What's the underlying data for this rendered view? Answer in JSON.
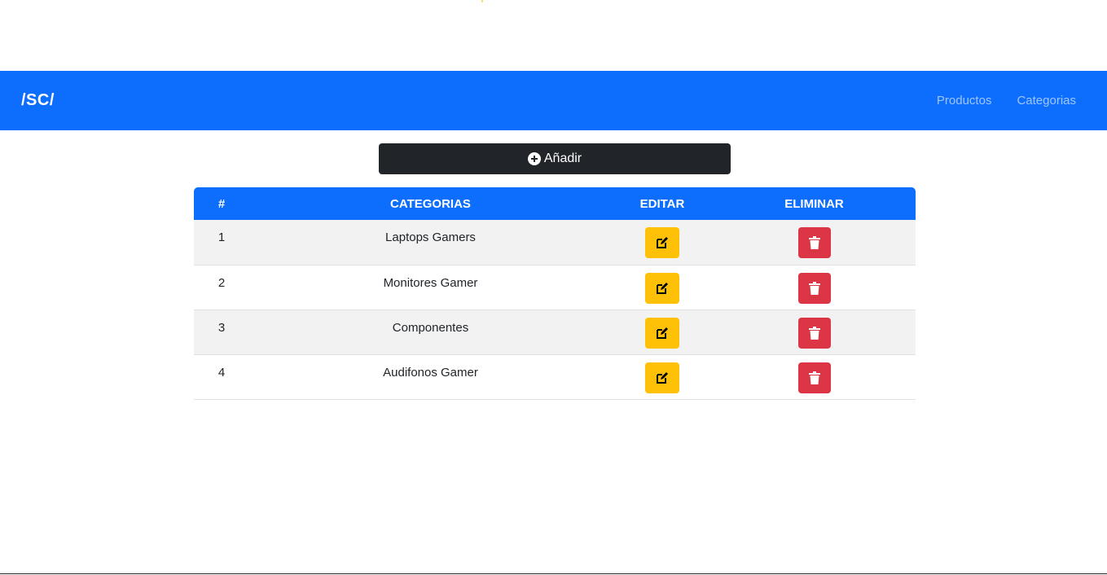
{
  "navbar": {
    "brand": "/SC/",
    "links": [
      {
        "label": "Productos"
      },
      {
        "label": "Categorias"
      }
    ]
  },
  "add_button": {
    "label": "Añadir",
    "icon": "plus-circle-icon"
  },
  "table": {
    "headers": [
      "#",
      "CATEGORIAS",
      "EDITAR",
      "ELIMINAR"
    ],
    "rows": [
      {
        "id": "1",
        "category": "Laptops Gamers"
      },
      {
        "id": "2",
        "category": "Monitores Gamer"
      },
      {
        "id": "3",
        "category": "Componentes"
      },
      {
        "id": "4",
        "category": "Audifonos Gamer"
      }
    ],
    "edit_icon": "edit-icon",
    "delete_icon": "trash-icon"
  },
  "colors": {
    "primary": "#0d6efd",
    "dark": "#212529",
    "warning": "#ffc107",
    "danger": "#dc3545"
  }
}
